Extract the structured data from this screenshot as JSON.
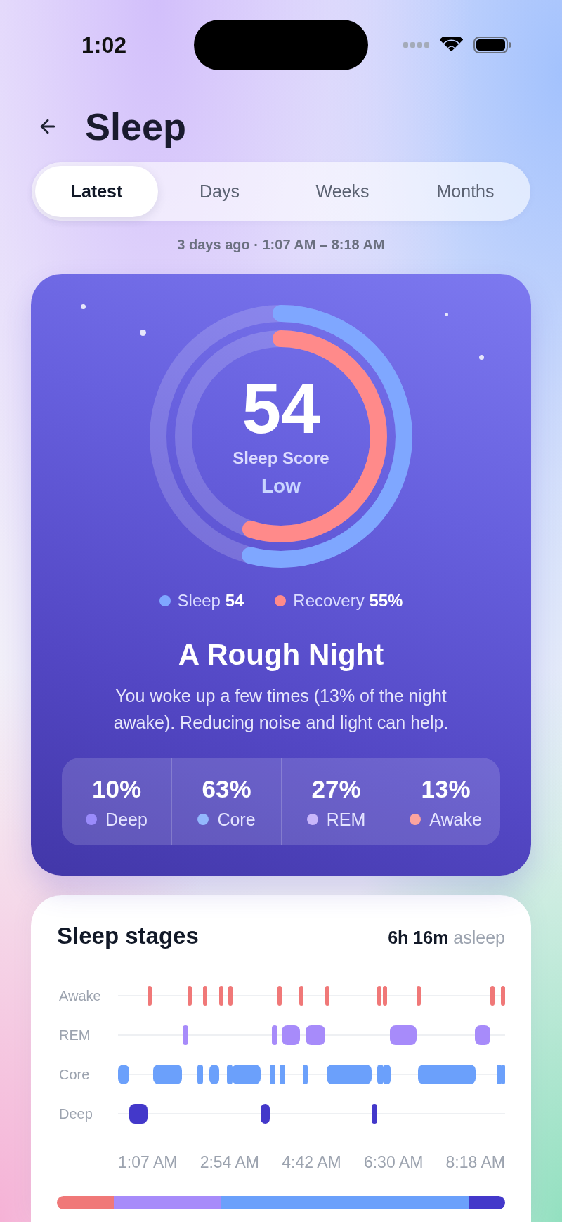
{
  "status_bar": {
    "time": "1:02"
  },
  "header": {
    "title": "Sleep"
  },
  "tabs": [
    {
      "label": "Latest",
      "selected": true
    },
    {
      "label": "Days",
      "selected": false
    },
    {
      "label": "Weeks",
      "selected": false
    },
    {
      "label": "Months",
      "selected": false
    }
  ],
  "period": "3 days ago · 1:07 AM – 8:18 AM",
  "score_card": {
    "score": "54",
    "score_label": "Sleep Score",
    "rating": "Low",
    "rings": [
      {
        "level": 0.54,
        "color": "#7fa7ff"
      },
      {
        "level": 0.55,
        "color": "#ff8a8a"
      }
    ],
    "legend": [
      {
        "label": "Sleep **54**",
        "color": "#7fa7ff"
      },
      {
        "label": "Recovery **55%**",
        "color": "#ff8a8a"
      }
    ],
    "headline": "A Rough Night",
    "message": "You woke up a few times (13% of the night awake). Reducing noise and light can help.",
    "stats": [
      {
        "value": "10%",
        "label": "Deep",
        "color": "#9a8bfb"
      },
      {
        "value": "63%",
        "label": "Core",
        "color": "#93b8fd"
      },
      {
        "value": "27%",
        "label": "REM",
        "color": "#c8b6fb"
      },
      {
        "value": "13%",
        "label": "Awake",
        "color": "#fca49f"
      }
    ]
  },
  "stages_card": {
    "title": "Sleep stages",
    "summary": "**6h 16m** asleep",
    "rows": [
      {
        "label": "Awake",
        "color": "#f07878"
      },
      {
        "label": "REM",
        "color": "#a78bfa"
      },
      {
        "label": "Core",
        "color": "#6ba0fb"
      },
      {
        "label": "Deep",
        "color": "#4338ca"
      }
    ],
    "times": [
      "1:07 AM",
      "2:54 AM",
      "4:42 AM",
      "6:30 AM",
      "8:18 AM"
    ]
  }
}
